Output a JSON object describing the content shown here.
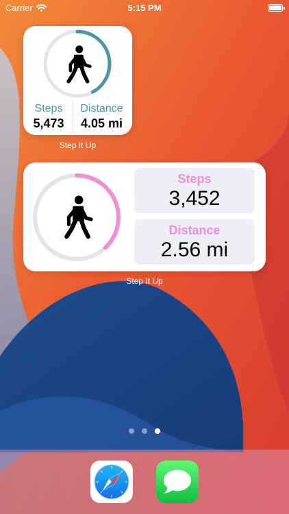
{
  "status_bar": {
    "carrier": "Carrier",
    "time": "5:15 PM",
    "icons": [
      "wifi-icon",
      "battery-icon"
    ]
  },
  "widgets": {
    "small": {
      "ring_color": "#4e94a8",
      "progress": 0.42,
      "icon": "walking-person-icon",
      "steps_label": "Steps",
      "steps_value": "5,473",
      "distance_label": "Distance",
      "distance_value": "4.05 mi",
      "caption": "Step It Up"
    },
    "medium": {
      "ring_color": "#f08fd5",
      "progress": 0.38,
      "icon": "walking-person-icon",
      "steps_label": "Steps",
      "steps_value": "3,452",
      "distance_label": "Distance",
      "distance_value": "2.56 mi",
      "caption": "Step It Up"
    }
  },
  "page_indicator": {
    "pages": 3,
    "current": 3
  },
  "dock": {
    "apps": [
      {
        "name": "Safari",
        "icon": "safari-icon"
      },
      {
        "name": "Messages",
        "icon": "messages-icon"
      }
    ]
  },
  "colors": {
    "accent_teal": "#4e94a8",
    "accent_pink": "#f08fd5",
    "panel_bg": "#eeeef6"
  }
}
